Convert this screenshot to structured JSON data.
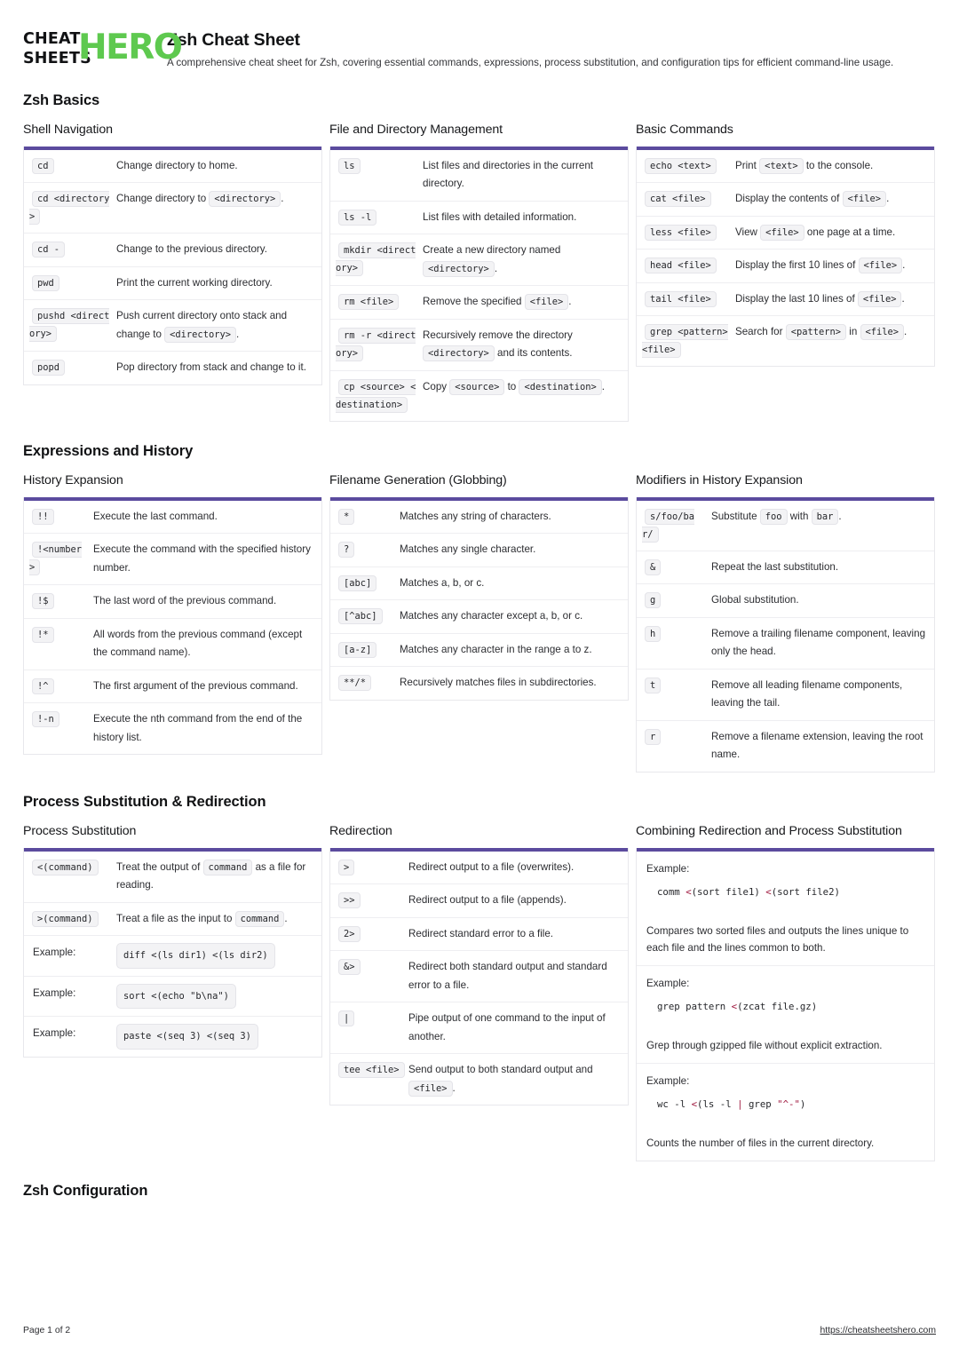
{
  "brand": {
    "line1": "CHEAT",
    "line2": "SHEETS",
    "hero": "HERO",
    "green": "#5ec94f"
  },
  "header": {
    "title": "Zsh Cheat Sheet",
    "subtitle": "A comprehensive cheat sheet for Zsh, covering essential commands, expressions, process substitution, and configuration tips for efficient command-line usage."
  },
  "accent": "#5b4b9e",
  "groups": [
    {
      "title": "Zsh Basics"
    },
    {
      "title": "Expressions and History"
    },
    {
      "title": "Process Substitution & Redirection"
    },
    {
      "title": "Zsh Configuration"
    }
  ],
  "cards": {
    "shell_navigation": {
      "title": "Shell Navigation",
      "rows": [
        {
          "key": "cd",
          "desc": "Change directory to home."
        },
        {
          "key": "cd <directory>",
          "desc": "Change directory to <directory>."
        },
        {
          "key": "cd -",
          "desc": "Change to the previous directory."
        },
        {
          "key": "pwd",
          "desc": "Print the current working directory."
        },
        {
          "key": "pushd <directory>",
          "desc": "Push current directory onto stack and change to <directory>."
        },
        {
          "key": "popd",
          "desc": "Pop directory from stack and change to it."
        }
      ]
    },
    "file_directory": {
      "title": "File and Directory Management",
      "rows": [
        {
          "key": "ls",
          "desc": "List files and directories in the current directory."
        },
        {
          "key": "ls -l",
          "desc": "List files with detailed information."
        },
        {
          "key": "mkdir <directory>",
          "desc": "Create a new directory named <directory>."
        },
        {
          "key": "rm <file>",
          "desc": "Remove the specified <file>."
        },
        {
          "key": "rm -r <directory>",
          "desc": "Recursively remove the directory <directory> and its contents."
        },
        {
          "key": "cp <source> <destination>",
          "desc": "Copy <source> to <destination>."
        }
      ]
    },
    "basic_commands": {
      "title": "Basic Commands",
      "rows": [
        {
          "key": "echo <text>",
          "desc": "Print <text> to the console."
        },
        {
          "key": "cat <file>",
          "desc": "Display the contents of <file>."
        },
        {
          "key": "less <file>",
          "desc": "View <file> one page at a time."
        },
        {
          "key": "head <file>",
          "desc": "Display the first 10 lines of <file>."
        },
        {
          "key": "tail <file>",
          "desc": "Display the last 10 lines of <file>."
        },
        {
          "key": "grep <pattern> <file>",
          "desc": "Search for <pattern> in <file>."
        }
      ]
    },
    "history_expansion": {
      "title": "History Expansion",
      "rows": [
        {
          "key": "!!",
          "desc": "Execute the last command."
        },
        {
          "key": "!<number>",
          "desc": "Execute the command with the specified history number."
        },
        {
          "key": "!$",
          "desc": "The last word of the previous command."
        },
        {
          "key": "!*",
          "desc": "All words from the previous command (except the command name)."
        },
        {
          "key": "!^",
          "desc": "The first argument of the previous command."
        },
        {
          "key": "!-n",
          "desc": "Execute the nth command from the end of the history list."
        }
      ]
    },
    "globbing": {
      "title": "Filename Generation (Globbing)",
      "rows": [
        {
          "key": "*",
          "desc": "Matches any string of characters."
        },
        {
          "key": "?",
          "desc": "Matches any single character."
        },
        {
          "key": "[abc]",
          "desc": "Matches a, b, or c."
        },
        {
          "key": "[^abc]",
          "desc": "Matches any character except a, b, or c."
        },
        {
          "key": "[a-z]",
          "desc": "Matches any character in the range a to z."
        },
        {
          "key": "**/*",
          "desc": "Recursively matches files in subdirectories."
        }
      ]
    },
    "modifiers": {
      "title": "Modifiers in History Expansion",
      "rows": [
        {
          "key": "s/foo/bar/",
          "desc": "Substitute foo with bar."
        },
        {
          "key": "&",
          "desc": "Repeat the last substitution."
        },
        {
          "key": "g",
          "desc": "Global substitution."
        },
        {
          "key": "h",
          "desc": "Remove a trailing filename component, leaving only the head."
        },
        {
          "key": "t",
          "desc": "Remove all leading filename components, leaving the tail."
        },
        {
          "key": "r",
          "desc": "Remove a filename extension, leaving the root name."
        }
      ]
    },
    "process_substitution": {
      "title": "Process Substitution",
      "rows": [
        {
          "key": "<(command)",
          "desc": "Treat the output of command as a file for reading."
        },
        {
          "key": ">(command)",
          "desc": "Treat a file as the input to command."
        },
        {
          "key": "Example:",
          "desc": "diff <(ls dir1) <(ls dir2)"
        },
        {
          "key": "Example:",
          "desc": "sort <(echo \"b\\na\")"
        },
        {
          "key": "Example:",
          "desc": "paste <(seq 3) <(seq 3)"
        }
      ]
    },
    "redirection": {
      "title": "Redirection",
      "rows": [
        {
          "key": ">",
          "desc": "Redirect output to a file (overwrites)."
        },
        {
          "key": ">>",
          "desc": "Redirect output to a file (appends)."
        },
        {
          "key": "2>",
          "desc": "Redirect standard error to a file."
        },
        {
          "key": "&>",
          "desc": "Redirect both standard output and standard error to a file."
        },
        {
          "key": "|",
          "desc": "Pipe output of one command to the input of another."
        },
        {
          "key": "tee <file>",
          "desc": "Send output to both standard output and <file>."
        }
      ]
    },
    "combining": {
      "title": "Combining Redirection and Process Substitution",
      "examples": [
        {
          "label": "Example:",
          "code": "comm <(sort file1) <(sort file2)",
          "desc": "Compares two sorted files and outputs the lines unique to each file and the lines common to both."
        },
        {
          "label": "Example:",
          "code": "grep pattern <(zcat file.gz)",
          "desc": "Grep through gzipped file without explicit extraction."
        },
        {
          "label": "Example:",
          "code": "wc -l <(ls -l | grep \"^-\")",
          "desc": "Counts the number of files in the current directory."
        }
      ]
    }
  },
  "footer": {
    "page": "Page 1 of 2",
    "url": "https://cheatsheetshero.com"
  }
}
